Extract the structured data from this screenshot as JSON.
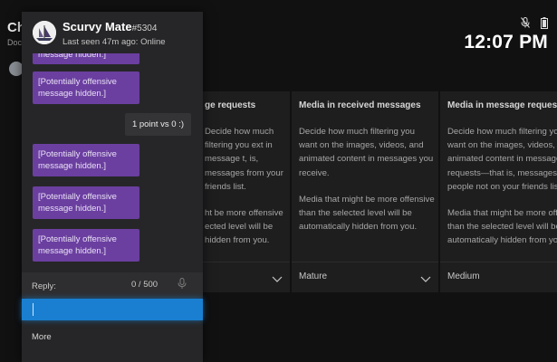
{
  "background": {
    "page_title": "Ch",
    "page_subtitle": "Doc",
    "time": "12:07 PM",
    "cards": [
      {
        "title": "ge requests",
        "desc": [
          "Decide how much filtering you ext in message t, is, messages from your friends list.",
          "ht be more offensive ected level will be hidden from you."
        ],
        "value": ""
      },
      {
        "title": "Media in received messages",
        "desc": [
          "Decide how much filtering you want on the images, videos, and animated content in messages you receive.",
          "Media that might be more offensive than the selected level will be automatically hidden from you."
        ],
        "value": "Mature"
      },
      {
        "title": "Media in message requests",
        "desc": [
          "Decide how much filtering you want on the images, videos, and animated content in message requests—that is, messages from people not on your friends list.",
          "Media that might be more offensive than the selected level will be automatically hidden from you."
        ],
        "value": "Medium"
      }
    ]
  },
  "chat": {
    "contact_name": "Scurvy Mate",
    "gamertag_suffix": "#5304",
    "last_seen": "Last seen 47m ago: Online",
    "messages": [
      {
        "from": "them",
        "text": "message hidden.]"
      },
      {
        "from": "them",
        "text": "[Potentially offensive message hidden.]"
      },
      {
        "from": "me",
        "text": "1 point vs 0 :)"
      },
      {
        "from": "them",
        "text": "[Potentially offensive message hidden.]"
      },
      {
        "from": "them",
        "text": "[Potentially offensive message hidden.]"
      },
      {
        "from": "them",
        "text": "[Potentially offensive message hidden.]"
      }
    ],
    "reply_label": "Reply:",
    "char_count": "0 / 500",
    "more_label": "More"
  },
  "colors": {
    "bubble": "#6b3fa0",
    "accent": "#1a7fd0",
    "panel": "#262628"
  }
}
